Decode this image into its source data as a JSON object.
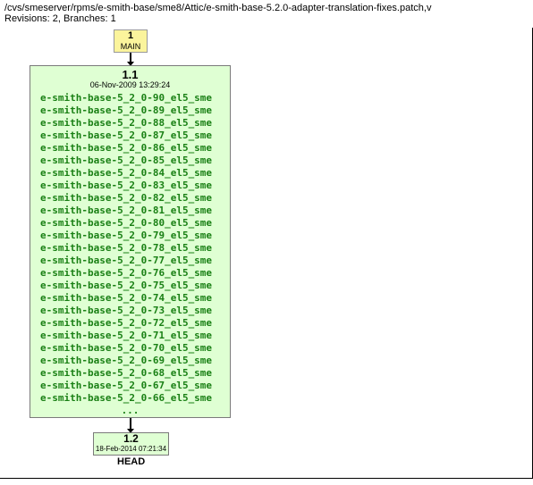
{
  "header": {
    "path": "/cvs/smeserver/rpms/e-smith-base/sme8/Attic/e-smith-base-5.2.0-adapter-translation-fixes.patch,v",
    "revisions_text": "Revisions: 2, Branches: 1"
  },
  "main_node": {
    "num": "1",
    "label": "MAIN"
  },
  "big_node": {
    "version": "1.1",
    "date": "06-Nov-2009 13:29:24",
    "files": [
      "e-smith-base-5_2_0-90_el5_sme",
      "e-smith-base-5_2_0-89_el5_sme",
      "e-smith-base-5_2_0-88_el5_sme",
      "e-smith-base-5_2_0-87_el5_sme",
      "e-smith-base-5_2_0-86_el5_sme",
      "e-smith-base-5_2_0-85_el5_sme",
      "e-smith-base-5_2_0-84_el5_sme",
      "e-smith-base-5_2_0-83_el5_sme",
      "e-smith-base-5_2_0-82_el5_sme",
      "e-smith-base-5_2_0-81_el5_sme",
      "e-smith-base-5_2_0-80_el5_sme",
      "e-smith-base-5_2_0-79_el5_sme",
      "e-smith-base-5_2_0-78_el5_sme",
      "e-smith-base-5_2_0-77_el5_sme",
      "e-smith-base-5_2_0-76_el5_sme",
      "e-smith-base-5_2_0-75_el5_sme",
      "e-smith-base-5_2_0-74_el5_sme",
      "e-smith-base-5_2_0-73_el5_sme",
      "e-smith-base-5_2_0-72_el5_sme",
      "e-smith-base-5_2_0-71_el5_sme",
      "e-smith-base-5_2_0-70_el5_sme",
      "e-smith-base-5_2_0-69_el5_sme",
      "e-smith-base-5_2_0-68_el5_sme",
      "e-smith-base-5_2_0-67_el5_sme",
      "e-smith-base-5_2_0-66_el5_sme"
    ],
    "dots": "..."
  },
  "bottom_node": {
    "version": "1.2",
    "date": "18-Feb-2014 07:21:34"
  },
  "head_label": "HEAD"
}
